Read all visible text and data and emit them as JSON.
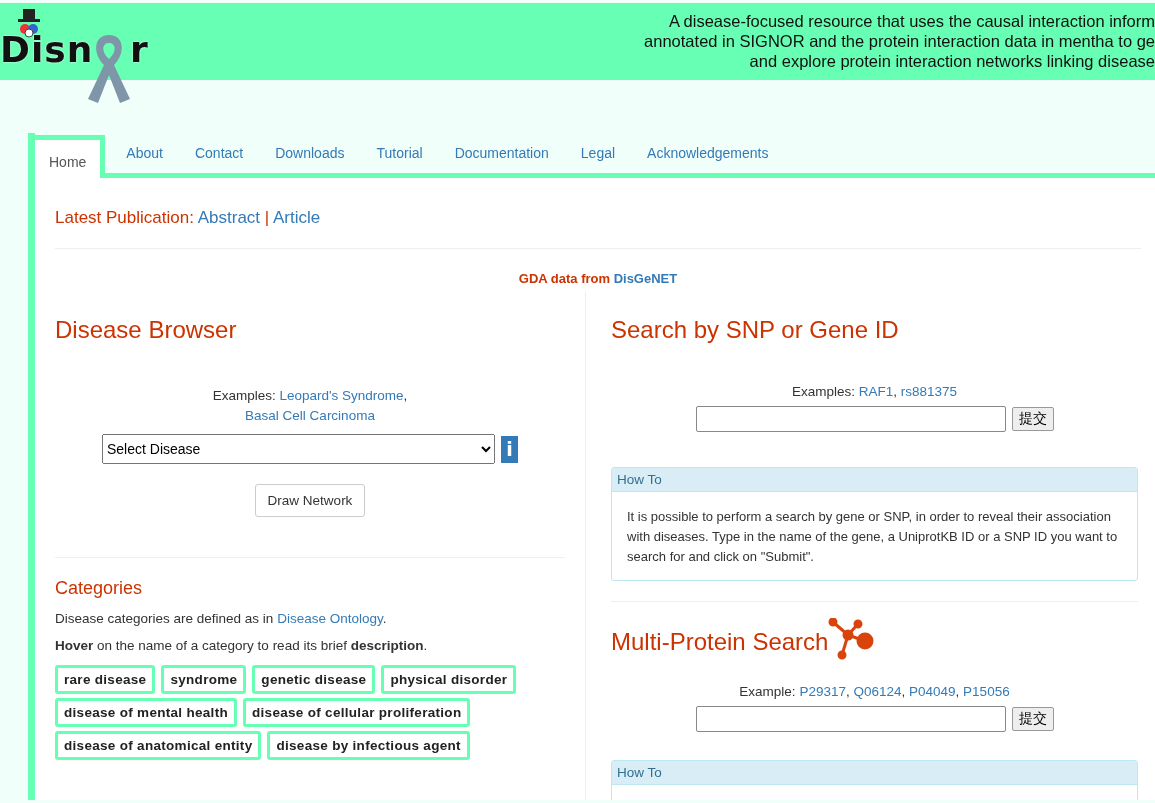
{
  "header": {
    "logo_left": "Disn",
    "logo_right": "r",
    "tagline": [
      "A disease-focused resource that uses the causal interaction inform",
      "annotated in SIGNOR and the protein interaction data in mentha to ge",
      "and explore protein interaction networks linking disease"
    ]
  },
  "tabs": [
    {
      "label": "Home",
      "selected": true
    },
    {
      "label": "About",
      "selected": false
    },
    {
      "label": "Contact",
      "selected": false
    },
    {
      "label": "Downloads",
      "selected": false
    },
    {
      "label": "Tutorial",
      "selected": false
    },
    {
      "label": "Documentation",
      "selected": false
    },
    {
      "label": "Legal",
      "selected": false
    },
    {
      "label": "Acknowledgements",
      "selected": false
    }
  ],
  "publication": {
    "label": "Latest Publication:",
    "links": [
      "Abstract",
      "Article"
    ],
    "separator": "|"
  },
  "source": {
    "label": "GDA data from",
    "link": "DisGeNET"
  },
  "disease_browser": {
    "title": "Disease Browser",
    "examples_label": "Examples:",
    "examples": [
      "Leopard's Syndrome",
      "Basal Cell Carcinoma"
    ],
    "separator": ",",
    "select": "Select Disease",
    "info_button": "i",
    "button": "Draw Network"
  },
  "categories": {
    "title": "Categories",
    "note_before": "Disease categories are defined as in",
    "note_link": "Disease Ontology",
    "note_after": ".",
    "hint": "**Hover** on the name of a category to read its brief **description**.",
    "tags": [
      "rare disease",
      "syndrome",
      "genetic disease",
      "physical disorder",
      "disease of mental health",
      "disease of cellular proliferation",
      "disease of anatomical entity",
      "disease by infectious agent"
    ]
  },
  "snp_search": {
    "title": "Search by SNP or Gene ID",
    "examples_label": "Examples:",
    "examples": [
      "RAF1",
      "rs881375"
    ],
    "separator": ",",
    "submit": "提交",
    "howto": {
      "title": "How To",
      "body": "It is possible to perform a search by gene or SNP, in order to reveal their association with diseases. Type in the name of the gene, a UniprotKB ID or a SNP ID you want to search for and click on \"Submit\"."
    }
  },
  "multi_search": {
    "title": "Multi-Protein Search",
    "examples_label": "Example:",
    "examples": [
      "P29317",
      "Q06124",
      "P04049",
      "P15056"
    ],
    "separator": ",",
    "submit": "提交",
    "howto": {
      "title": "How To"
    }
  }
}
